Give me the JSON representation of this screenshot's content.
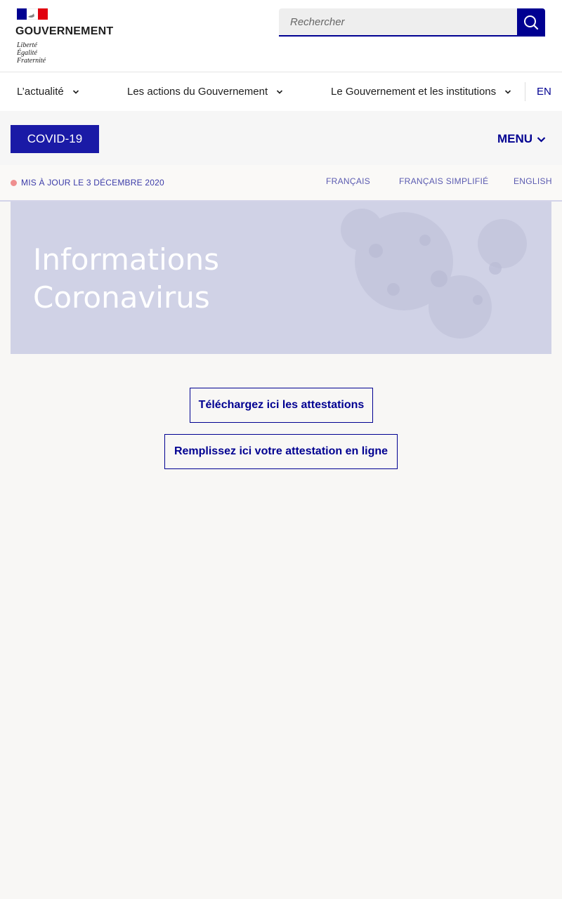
{
  "header": {
    "brand": "GOUVERNEMENT",
    "motto": [
      "Liberté",
      "Égalité",
      "Fraternité"
    ],
    "search_placeholder": "Rechercher"
  },
  "nav": {
    "items": [
      {
        "label": "L’actualité"
      },
      {
        "label": "Les actions du Gouvernement"
      },
      {
        "label": "Le Gouvernement et les institutions"
      }
    ],
    "lang_switch": "EN"
  },
  "covid_bar": {
    "badge": "COVID-19",
    "menu_label": "MENU"
  },
  "update": {
    "text": "MIS À JOUR LE 3 DÉCEMBRE 2020",
    "languages": [
      "FRANÇAIS",
      "FRANÇAIS SIMPLIFIÉ",
      "ENGLISH"
    ]
  },
  "hero": {
    "title_lines": [
      "Informations",
      "Coronavirus"
    ]
  },
  "actions": {
    "download": "Téléchargez ici les attestations",
    "online": "Remplissez ici votre attestation en ligne"
  },
  "colors": {
    "accent": "#000091",
    "badge": "#1a1aa6",
    "hero_bg": "#d0d2e6",
    "page_bg": "#f8f7f5",
    "flag_red": "#e1000f"
  }
}
